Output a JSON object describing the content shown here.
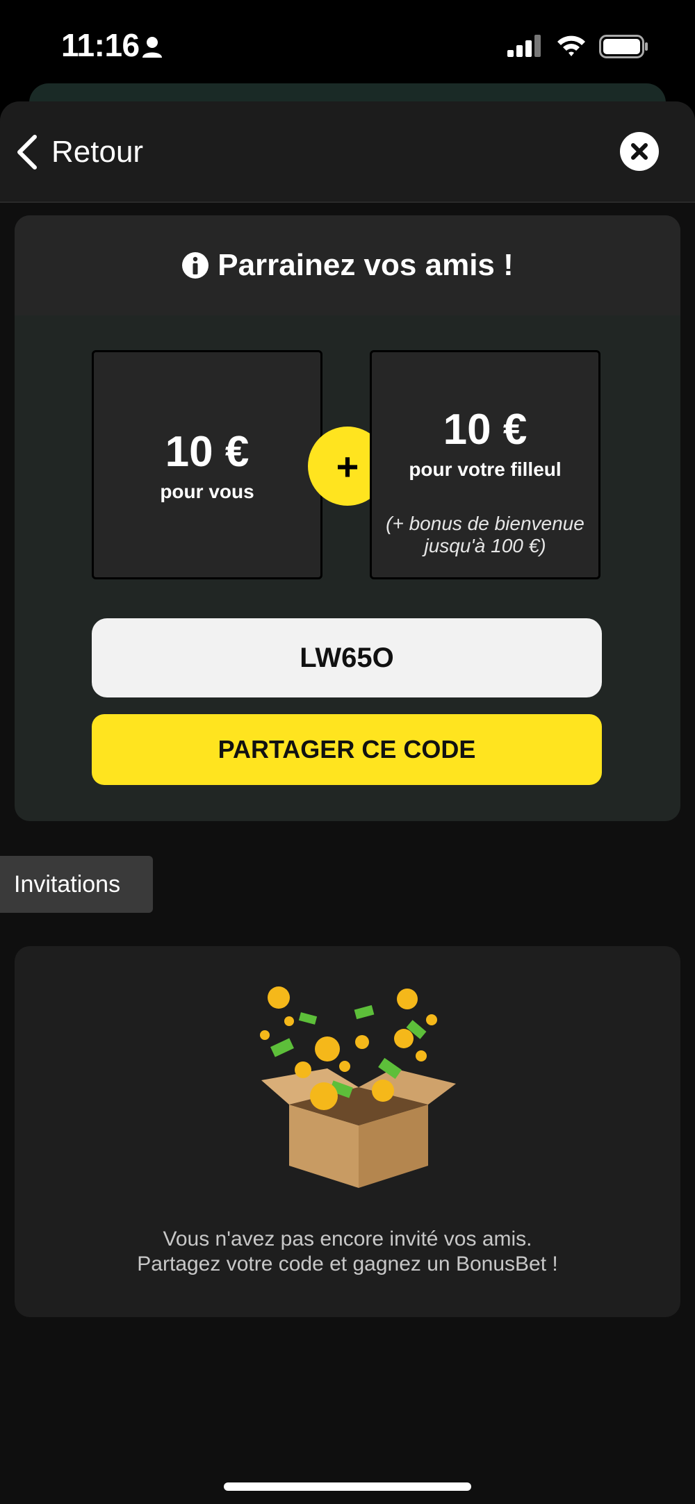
{
  "status_bar": {
    "time": "11:16"
  },
  "header": {
    "back_label": "Retour"
  },
  "referral": {
    "title": "Parrainez vos amis !",
    "you": {
      "amount": "10 €",
      "label": "pour vous"
    },
    "plus": "+",
    "friend": {
      "amount": "10 €",
      "label": "pour votre filleul",
      "note_line1": "(+ bonus de bienvenue",
      "note_line2": "jusqu'à 100 €)"
    },
    "code": "LW65O",
    "share_label": "PARTAGER CE CODE"
  },
  "invitations": {
    "tab_label": "Invitations",
    "empty_line1": "Vous n'avez pas encore invité vos amis.",
    "empty_line2": "Partagez votre code et gagnez un BonusBet !"
  },
  "colors": {
    "accent_yellow": "#ffe41f",
    "background": "#0f0f0f",
    "card": "#212624"
  }
}
